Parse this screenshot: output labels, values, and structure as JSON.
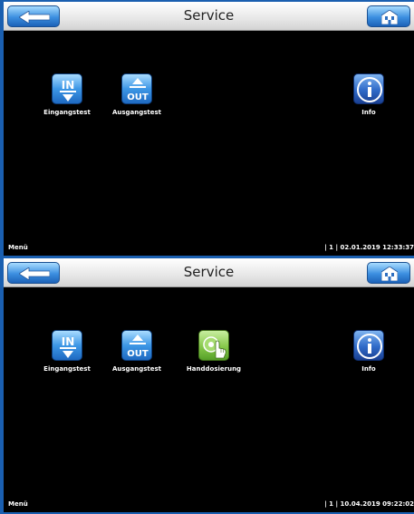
{
  "colors": {
    "frame": "#1a5fb0",
    "screen_bg": "#000000",
    "header_bg": "#e7e7e7",
    "blue_button": "#3c8fe0",
    "green_icon": "#86c84a",
    "label_text": "#ffffff"
  },
  "screens": [
    {
      "title": "Service",
      "tiles": [
        {
          "label": "Eingangstest",
          "icon": "input-in-icon"
        },
        {
          "label": "Ausgangstest",
          "icon": "output-out-icon"
        },
        {
          "label": "Info",
          "icon": "info-icon"
        }
      ],
      "footer": {
        "menu": "Menü",
        "page": "| 1 |",
        "datetime": "02.01.2019 12:33:37"
      }
    },
    {
      "title": "Service",
      "tiles": [
        {
          "label": "Eingangstest",
          "icon": "input-in-icon"
        },
        {
          "label": "Ausgangstest",
          "icon": "output-out-icon"
        },
        {
          "label": "Handdosierung",
          "icon": "hand-dosing-icon"
        },
        {
          "label": "Info",
          "icon": "info-icon"
        }
      ],
      "footer": {
        "menu": "Menü",
        "page": "| 1 |",
        "datetime": "10.04.2019 09:22:02"
      }
    }
  ],
  "icons": {
    "back": "back-arrow-icon",
    "home": "home-icon"
  }
}
